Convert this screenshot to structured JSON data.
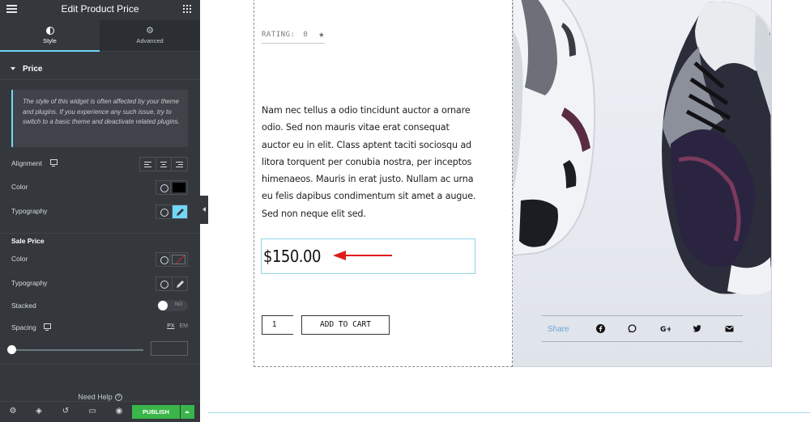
{
  "panel": {
    "title": "Edit Product Price",
    "tabs": [
      {
        "label": "Style"
      },
      {
        "label": "Advanced"
      }
    ],
    "section": "Price",
    "notice": "The style of this widget is often affected by your theme and plugins. If you experience any such issue, try to switch to a basic theme and deactivate related plugins.",
    "controls": {
      "alignment": "Alignment",
      "color": "Color",
      "typography": "Typography"
    },
    "sale_section": "Sale Price",
    "sale_controls": {
      "color": "Color",
      "typography": "Typography",
      "stacked": "Stacked",
      "stacked_toggle": "NO",
      "spacing": "Spacing",
      "unit_px": "PX",
      "unit_em": "EM"
    },
    "help": "Need Help",
    "publish": "PUBLISH"
  },
  "product": {
    "rating_label": "RATING:",
    "rating_value": "0",
    "description": "Nam nec tellus a odio tincidunt auctor a ornare odio. Sed non mauris vitae erat consequat auctor eu in elit. Class aptent taciti sociosqu ad litora torquent per conubia nostra, per inceptos himenaeos. Mauris in erat justo. Nullam ac urna eu felis dapibus condimentum sit amet a augue. Sed non neque elit sed.",
    "price": "$150.00",
    "quantity": "1",
    "add_to_cart": "ADD TO CART",
    "share_label": "Share"
  },
  "colors": {
    "accent": "#71d7f7",
    "publish": "#39b54a",
    "arrow": "#e01b1b",
    "share_text": "#6ea6d8"
  }
}
